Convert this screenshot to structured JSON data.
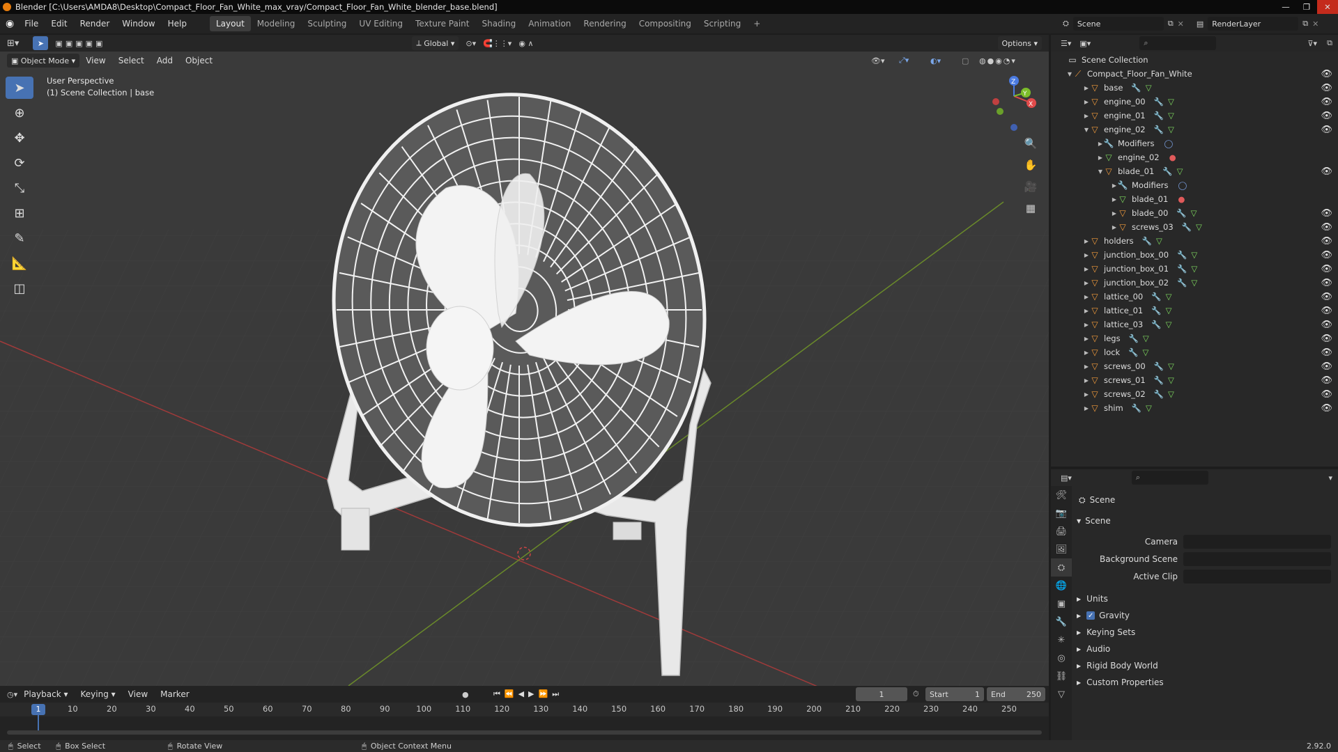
{
  "window": {
    "title": "Blender [C:\\Users\\AMDA8\\Desktop\\Compact_Floor_Fan_White_max_vray/Compact_Floor_Fan_White_blender_base.blend]"
  },
  "menus": [
    "File",
    "Edit",
    "Render",
    "Window",
    "Help"
  ],
  "workspaces": [
    "Layout",
    "Modeling",
    "Sculpting",
    "UV Editing",
    "Texture Paint",
    "Shading",
    "Animation",
    "Rendering",
    "Compositing",
    "Scripting"
  ],
  "scene_name": "Scene",
  "layer_name": "RenderLayer",
  "viewport": {
    "mode": "Object Mode",
    "menus": [
      "View",
      "Select",
      "Add",
      "Object"
    ],
    "transform": "Global",
    "options": "Options",
    "info_line1": "User Perspective",
    "info_line2": "(1) Scene Collection | base"
  },
  "outliner": {
    "root": "Scene Collection",
    "collection": "Compact_Floor_Fan_White",
    "rows": [
      {
        "label": "base",
        "kind": "obj",
        "depth": 2,
        "open": false,
        "eye": true
      },
      {
        "label": "engine_00",
        "kind": "obj",
        "depth": 2,
        "open": false,
        "eye": true
      },
      {
        "label": "engine_01",
        "kind": "obj",
        "depth": 2,
        "open": false,
        "eye": true
      },
      {
        "label": "engine_02",
        "kind": "obj",
        "depth": 2,
        "open": true,
        "eye": true
      },
      {
        "label": "Modifiers",
        "kind": "mod",
        "depth": 3,
        "open": false,
        "eye": false
      },
      {
        "label": "engine_02",
        "kind": "mesh",
        "depth": 3,
        "open": false,
        "eye": false
      },
      {
        "label": "blade_01",
        "kind": "obj",
        "depth": 3,
        "open": true,
        "eye": true
      },
      {
        "label": "Modifiers",
        "kind": "mod",
        "depth": 4,
        "open": false,
        "eye": false
      },
      {
        "label": "blade_01",
        "kind": "mesh",
        "depth": 4,
        "open": false,
        "eye": false
      },
      {
        "label": "blade_00",
        "kind": "obj",
        "depth": 4,
        "open": false,
        "eye": true
      },
      {
        "label": "screws_03",
        "kind": "obj",
        "depth": 4,
        "open": false,
        "eye": true
      },
      {
        "label": "holders",
        "kind": "obj",
        "depth": 2,
        "open": false,
        "eye": true
      },
      {
        "label": "junction_box_00",
        "kind": "obj",
        "depth": 2,
        "open": false,
        "eye": true
      },
      {
        "label": "junction_box_01",
        "kind": "obj",
        "depth": 2,
        "open": false,
        "eye": true
      },
      {
        "label": "junction_box_02",
        "kind": "obj",
        "depth": 2,
        "open": false,
        "eye": true
      },
      {
        "label": "lattice_00",
        "kind": "obj",
        "depth": 2,
        "open": false,
        "eye": true
      },
      {
        "label": "lattice_01",
        "kind": "obj",
        "depth": 2,
        "open": false,
        "eye": true
      },
      {
        "label": "lattice_03",
        "kind": "obj",
        "depth": 2,
        "open": false,
        "eye": true
      },
      {
        "label": "legs",
        "kind": "obj",
        "depth": 2,
        "open": false,
        "eye": true
      },
      {
        "label": "lock",
        "kind": "obj",
        "depth": 2,
        "open": false,
        "eye": true
      },
      {
        "label": "screws_00",
        "kind": "obj",
        "depth": 2,
        "open": false,
        "eye": true
      },
      {
        "label": "screws_01",
        "kind": "obj",
        "depth": 2,
        "open": false,
        "eye": true
      },
      {
        "label": "screws_02",
        "kind": "obj",
        "depth": 2,
        "open": false,
        "eye": true
      },
      {
        "label": "shim",
        "kind": "obj",
        "depth": 2,
        "open": false,
        "eye": true
      }
    ]
  },
  "properties": {
    "context": "Scene",
    "panel": "Scene",
    "camera_label": "Camera",
    "bg_label": "Background Scene",
    "clip_label": "Active Clip",
    "sections": [
      "Units",
      "Gravity",
      "Keying Sets",
      "Audio",
      "Rigid Body World",
      "Custom Properties"
    ]
  },
  "timeline": {
    "menus": [
      "Playback",
      "Keying",
      "View",
      "Marker"
    ],
    "current_frame": "1",
    "start_label": "Start",
    "start": "1",
    "end_label": "End",
    "end": "250",
    "ticks": [
      "1",
      "10",
      "20",
      "30",
      "40",
      "50",
      "60",
      "70",
      "80",
      "90",
      "100",
      "110",
      "120",
      "130",
      "140",
      "150",
      "160",
      "170",
      "180",
      "190",
      "200",
      "210",
      "220",
      "230",
      "240",
      "250"
    ]
  },
  "statusbar": {
    "select": "Select",
    "box_select": "Box Select",
    "rotate": "Rotate View",
    "context_menu": "Object Context Menu",
    "version": "2.92.0"
  }
}
